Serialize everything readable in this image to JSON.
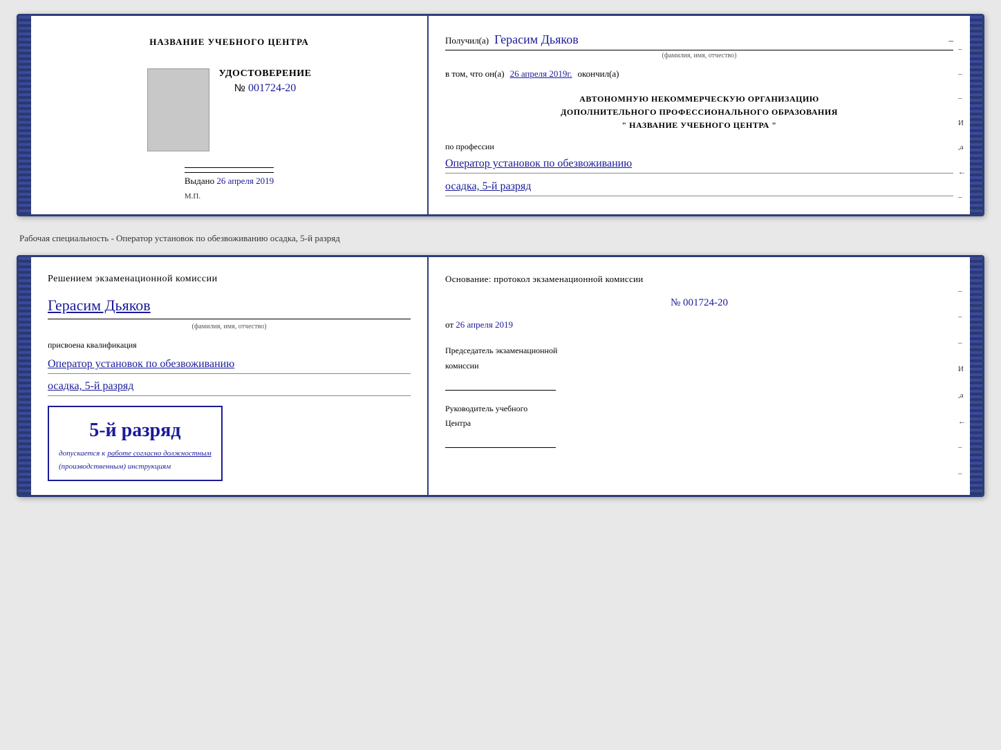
{
  "page": {
    "background_color": "#e8e8e8"
  },
  "cert1": {
    "left": {
      "header": "НАЗВАНИЕ УЧЕБНОГО ЦЕНТРА",
      "title": "УДОСТОВЕРЕНИЕ",
      "number_prefix": "№",
      "number": "001724-20",
      "issued_label": "Выдано",
      "issued_date": "26 апреля 2019",
      "stamp_label": "М.П."
    },
    "right": {
      "received_label": "Получил(а)",
      "recipient_name": "Герасим Дьяков",
      "recipient_sub": "(фамилия, имя, отчество)",
      "date_prefix": "в том, что он(а)",
      "date_value": "26 апреля 2019г.",
      "date_suffix": "окончил(а)",
      "org_line1": "АВТОНОМНУЮ НЕКОММЕРЧЕСКУЮ ОРГАНИЗАЦИЮ",
      "org_line2": "ДОПОЛНИТЕЛЬНОГО ПРОФЕССИОНАЛЬНОГО ОБРАЗОВАНИЯ",
      "org_line3": "\"   НАЗВАНИЕ УЧЕБНОГО ЦЕНТРА   \"",
      "profession_label": "по профессии",
      "profession_line1": "Оператор установок по обезвоживанию",
      "profession_line2": "осадка, 5-й разряд"
    }
  },
  "separator": {
    "text": "Рабочая специальность - Оператор установок по обезвоживанию осадка, 5-й разряд"
  },
  "cert2": {
    "left": {
      "decision_header": "Решением  экзаменационной  комиссии",
      "name": "Герасим Дьяков",
      "name_sub": "(фамилия, имя, отчество)",
      "qual_label": "присвоена квалификация",
      "qual_line1": "Оператор установок по обезвоживанию",
      "qual_line2": "осадка, 5-й разряд",
      "stamp_rank": "5-й разряд",
      "stamp_desc_prefix": "допускается к",
      "stamp_desc_link": "работе согласно должностным",
      "stamp_desc_suffix": "(производственным) инструкциям"
    },
    "right": {
      "basis_label": "Основание:  протокол  экзаменационной  комиссии",
      "protocol_number": "№  001724-20",
      "date_prefix": "от",
      "date_value": "26 апреля 2019",
      "commission_chair_label": "Председатель экзаменационной",
      "commission_chair_label2": "комиссии",
      "school_director_label": "Руководитель учебного",
      "school_director_label2": "Центра"
    }
  },
  "side_marks": {
    "items": [
      "–",
      "–",
      "–",
      "И",
      "а",
      "←",
      "–",
      "–",
      "–",
      "–",
      "–"
    ]
  }
}
